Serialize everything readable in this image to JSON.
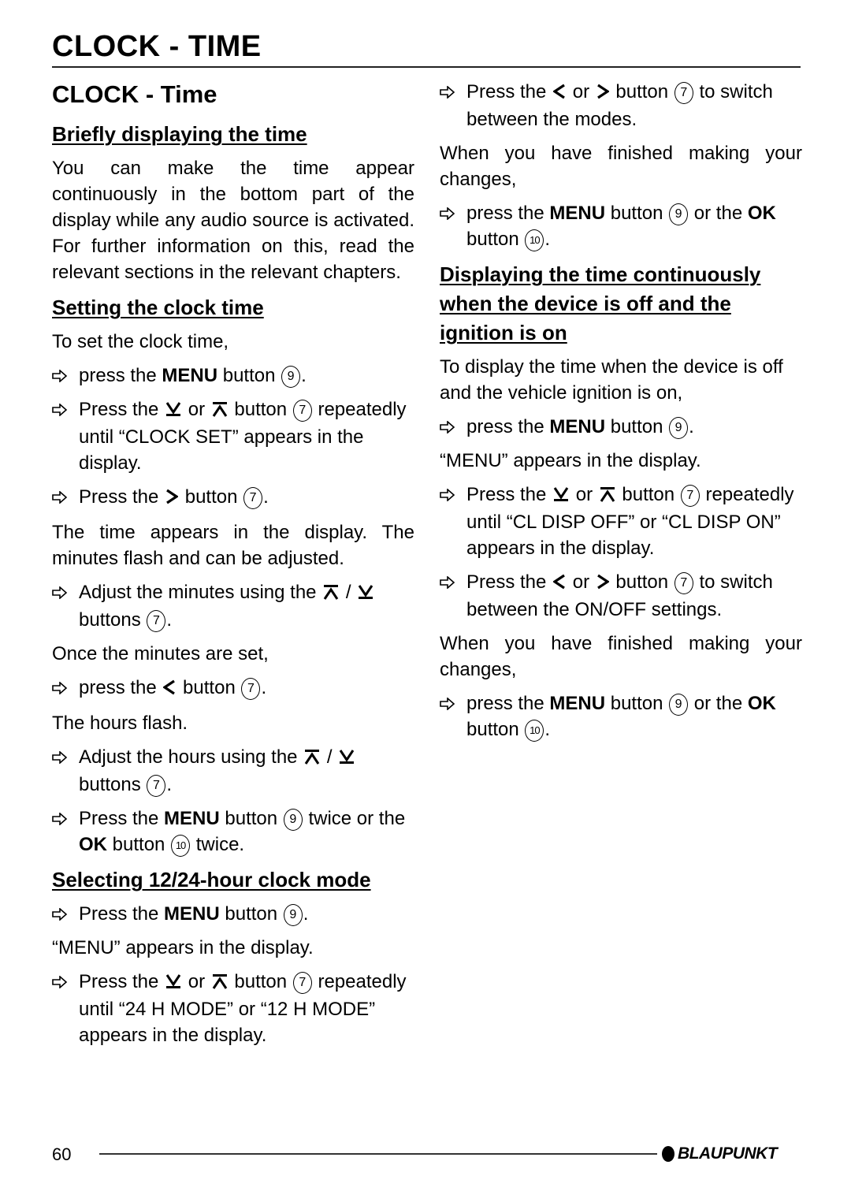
{
  "header": {
    "title": "CLOCK - TIME"
  },
  "section": {
    "title": "CLOCK - Time"
  },
  "brief": {
    "heading": "Briefly displaying the time",
    "body": "You can make the time appear continuously in the bottom part of the display while any audio source is activated. For further information on this, read the relevant sections in the relevant chapters."
  },
  "setting": {
    "heading": "Setting the clock time",
    "intro": "To set the clock time,",
    "s1": {
      "a": "press the ",
      "b": "MENU",
      "c": " button ",
      "n": "9",
      "d": "."
    },
    "s2": {
      "a": "Press the ",
      "or": " or ",
      "c": " button ",
      "n": "7",
      "d": " repeatedly until “CLOCK SET” appears in the display."
    },
    "s3": {
      "a": "Press the ",
      "c": " button ",
      "n": "7",
      "d": "."
    },
    "p1": "The time appears in the display. The minutes flash and can be adjusted.",
    "s4": {
      "a": "Adjust the minutes using the ",
      "slash": " / ",
      "c": " buttons ",
      "n": "7",
      "d": "."
    },
    "p2": "Once the minutes are set,",
    "s5": {
      "a": "press the ",
      "c": " button ",
      "n": "7",
      "d": "."
    },
    "p3": "The hours flash.",
    "s6": {
      "a": "Adjust the hours using the ",
      "slash": " / ",
      "c": " buttons ",
      "n": "7",
      "d": "."
    },
    "s7": {
      "a": "Press the ",
      "b": "MENU",
      "c": " button ",
      "n": "9",
      "d": " twice or the ",
      "b2": "OK",
      "e": " button ",
      "n2": "10",
      "f": " twice."
    }
  },
  "mode": {
    "heading": "Selecting 12/24-hour clock mode",
    "s1": {
      "a": "Press the ",
      "b": "MENU",
      "c": " button ",
      "n": "9",
      "d": "."
    },
    "p1": "“MENU” appears in the display.",
    "s2": {
      "a": "Press the ",
      "or": " or ",
      "c": " button ",
      "n": "7",
      "d": " repeatedly until “24 H MODE” or “12 H MODE” appears in the display."
    },
    "s3": {
      "a": "Press the ",
      "or": " or ",
      "c": " button ",
      "n": "7",
      "d": " to switch between the modes."
    },
    "p2": "When you have finished making your changes,",
    "s4": {
      "a": "press the ",
      "b": "MENU",
      "c": " button ",
      "n": "9",
      "d": " or the ",
      "b2": "OK",
      "e": " button ",
      "n2": "10",
      "f": "."
    }
  },
  "continuous": {
    "heading": "Displaying the time continuously when the device is off and the ignition is on",
    "intro": "To display the time when the device is off and the vehicle ignition is on,",
    "s1": {
      "a": "press the ",
      "b": "MENU",
      "c": " button ",
      "n": "9",
      "d": "."
    },
    "p1": "“MENU” appears in the display.",
    "s2": {
      "a": "Press the ",
      "or": " or ",
      "c": " button ",
      "n": "7",
      "d": " repeatedly until “CL DISP OFF” or “CL DISP ON” appears in the display."
    },
    "s3": {
      "a": "Press the ",
      "or": " or ",
      "c": " button ",
      "n": "7",
      "d": " to switch between the ON/OFF settings."
    },
    "p2": "When you have finished making your changes,",
    "s4": {
      "a": "press the ",
      "b": "MENU",
      "c": " button ",
      "n": "9",
      "d": " or the ",
      "b2": "OK",
      "e": " button ",
      "n2": "10",
      "f": "."
    }
  },
  "footer": {
    "page_number": "60",
    "brand": "BLAUPUNKT"
  }
}
